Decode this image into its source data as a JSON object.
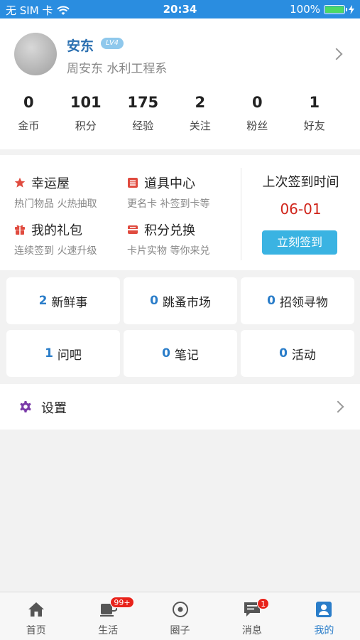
{
  "status_bar": {
    "carrier": "无 SIM 卡",
    "time": "20:34",
    "battery": "100%",
    "battery_level": 1.0
  },
  "profile": {
    "name": "安东",
    "level": "LV4",
    "subtitle": "周安东 水利工程系",
    "stats": [
      {
        "value": "0",
        "label": "金币"
      },
      {
        "value": "101",
        "label": "积分"
      },
      {
        "value": "175",
        "label": "经验"
      },
      {
        "value": "2",
        "label": "关注"
      },
      {
        "value": "0",
        "label": "粉丝"
      },
      {
        "value": "1",
        "label": "好友"
      }
    ]
  },
  "features": [
    {
      "title": "幸运屋",
      "desc": "热门物品 火热抽取",
      "icon": "star-icon"
    },
    {
      "title": "道具中心",
      "desc": "更名卡 补签到卡等",
      "icon": "toolbox-icon"
    },
    {
      "title": "我的礼包",
      "desc": "连续签到 火速升级",
      "icon": "gift-icon"
    },
    {
      "title": "积分兑换",
      "desc": "卡片实物 等你来兑",
      "icon": "exchange-icon"
    }
  ],
  "checkin": {
    "title": "上次签到时间",
    "date": "06-01",
    "button": "立刻签到"
  },
  "tiles": [
    {
      "count": "2",
      "label": "新鲜事"
    },
    {
      "count": "0",
      "label": "跳蚤市场"
    },
    {
      "count": "0",
      "label": "招领寻物"
    },
    {
      "count": "1",
      "label": "问吧"
    },
    {
      "count": "0",
      "label": "笔记"
    },
    {
      "count": "0",
      "label": "活动"
    }
  ],
  "settings": {
    "label": "设置",
    "icon": "gear-icon"
  },
  "tabbar": [
    {
      "label": "首页",
      "icon": "home-icon"
    },
    {
      "label": "生活",
      "icon": "coffee-cup-icon",
      "badge": "99+"
    },
    {
      "label": "圈子",
      "icon": "circle-icon"
    },
    {
      "label": "消息",
      "icon": "chat-icon",
      "badge": "1"
    },
    {
      "label": "我的",
      "icon": "profile-icon",
      "active": true
    }
  ],
  "colors": {
    "accent": "#2a8de0",
    "link": "#2a7dc9",
    "badge": "#e8231b",
    "checkin_date": "#d0251b",
    "checkin_button": "#3ab3e2"
  }
}
